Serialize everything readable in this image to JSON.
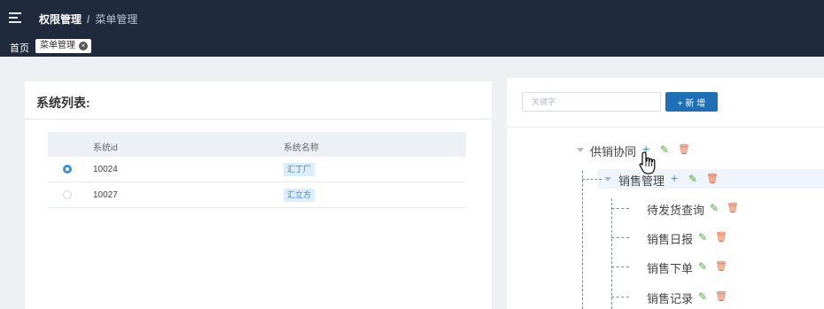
{
  "header": {
    "breadcrumb": [
      "权限管理",
      "菜单管理"
    ],
    "separator": "/"
  },
  "tags": {
    "home": "首页",
    "active": "菜单管理",
    "close_glyph": "×"
  },
  "left_panel": {
    "title": "系统列表:",
    "table": {
      "columns": [
        "系统id",
        "系统名称"
      ],
      "rows": [
        {
          "id": "10024",
          "name": "汇丁厂",
          "selected": true
        },
        {
          "id": "10027",
          "name": "汇立方",
          "selected": false
        }
      ]
    }
  },
  "right_panel": {
    "search_placeholder": "关键字",
    "add_button": "+ 新 增",
    "tree": {
      "root": {
        "label": "供销协同"
      },
      "child": {
        "label": "销售管理"
      },
      "leaves": [
        "待发货查询",
        "销售日报",
        "销售下单",
        "销售记录"
      ]
    }
  },
  "icons": {
    "add": "+",
    "edit": "✎",
    "delete": "🗑"
  },
  "colors": {
    "header_bg": "#1f2a3d",
    "primary": "#1e6fb5",
    "edit": "#4caa3a",
    "delete": "#e4693d"
  }
}
